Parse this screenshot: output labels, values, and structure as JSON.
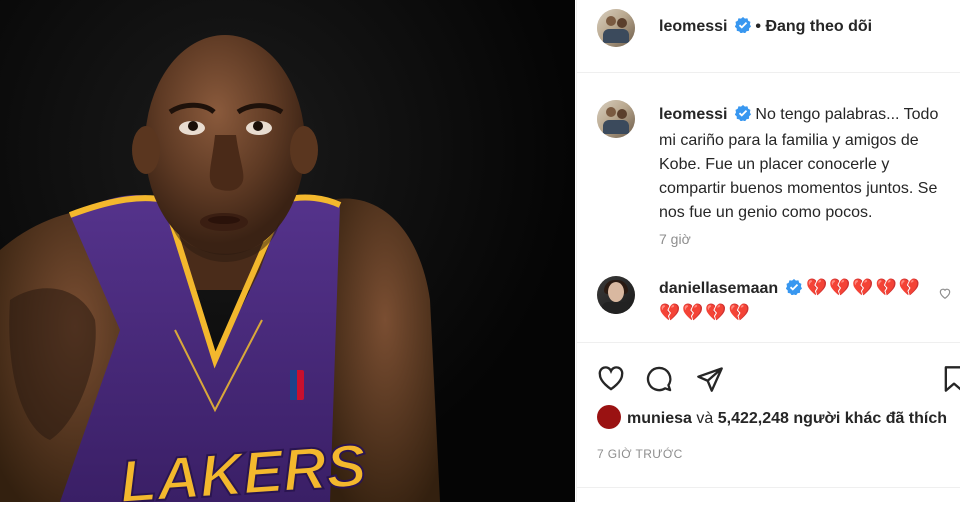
{
  "post": {
    "image_alt": "Kobe Bryant in Lakers jersey",
    "jersey_text": "LAKERS"
  },
  "header": {
    "username": "leomessi",
    "separator": "•",
    "follow_status": "Đang theo dõi"
  },
  "caption": {
    "username": "leomessi",
    "text": "No tengo palabras... Todo mi cariño para la familia y amigos de Kobe. Fue un placer conocerle y compartir buenos momentos juntos. Se nos fue un genio como pocos.",
    "time": "7 giờ"
  },
  "comments": [
    {
      "username": "daniellasemaan",
      "text": "💔💔💔💔💔💔💔💔💔"
    }
  ],
  "actions": {
    "like_icon": "heart-icon",
    "comment_icon": "comment-icon",
    "share_icon": "share-icon",
    "save_icon": "bookmark-icon"
  },
  "likes": {
    "first_user": "muniesa",
    "connector": "và",
    "count": "5,422,248",
    "suffix": "người khác đã thích"
  },
  "posted_time": "7 GIỜ TRƯỚC",
  "colors": {
    "verified": "#3897f0",
    "heart": "#c4161c",
    "muted": "#8e8e8e",
    "lakers_purple": "#4a2a7a",
    "lakers_gold": "#f3b82d"
  }
}
